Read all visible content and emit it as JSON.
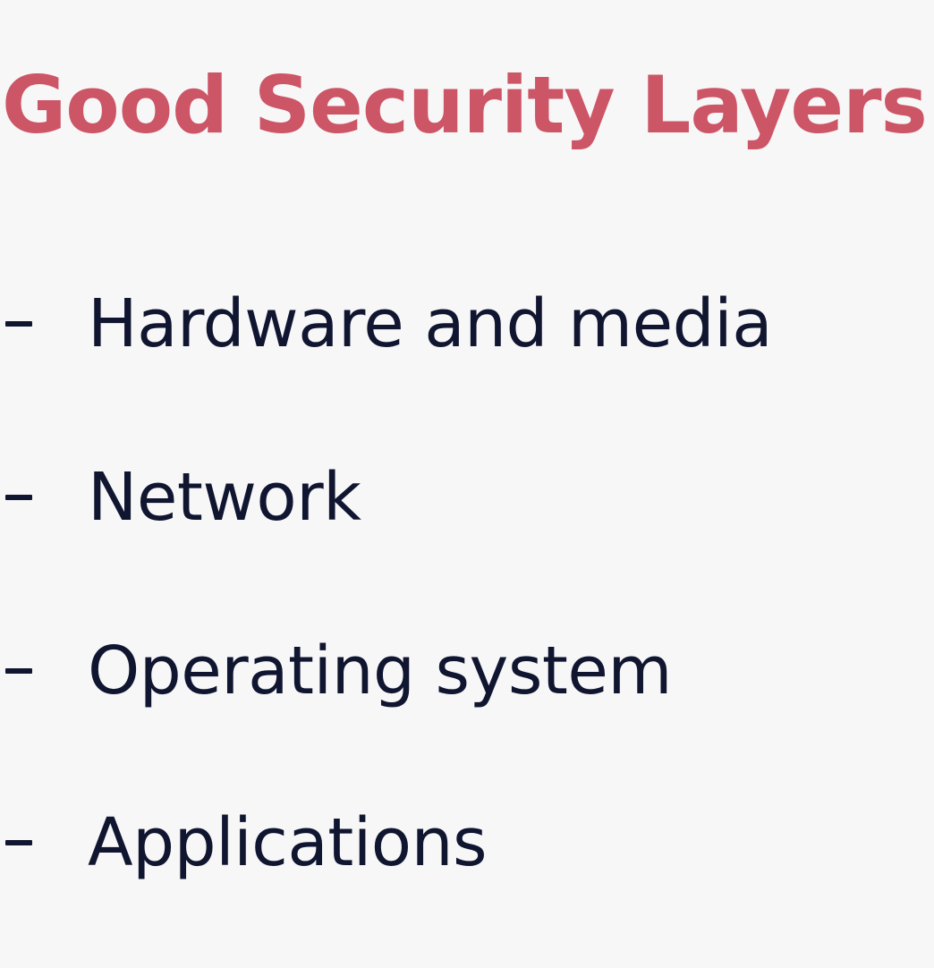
{
  "slide": {
    "title": "Good Security Layers",
    "items": [
      {
        "label": "Hardware and media"
      },
      {
        "label": "Network"
      },
      {
        "label": "Operating system"
      },
      {
        "label": "Applications"
      }
    ],
    "colors": {
      "background": "#f7f7f8",
      "title": "#cc5566",
      "text": "#101530",
      "bullet": "#101530"
    },
    "bullet_icon": "dash-icon"
  }
}
